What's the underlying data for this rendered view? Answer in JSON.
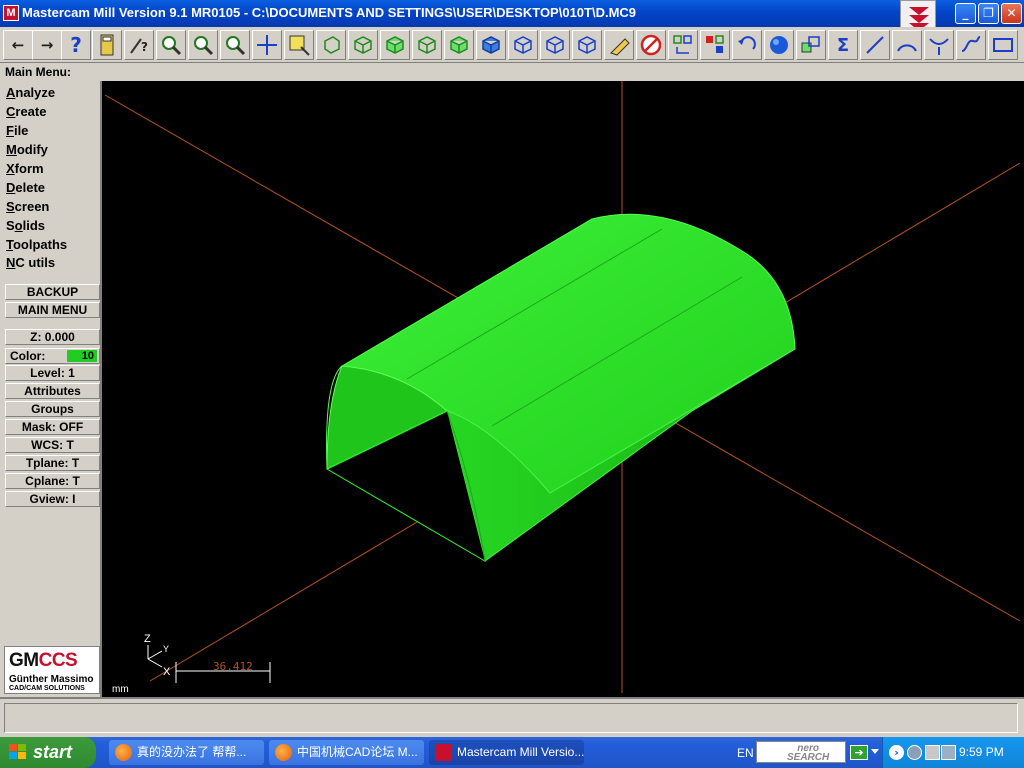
{
  "window": {
    "title": "Mastercam Mill Version 9.1 MR0105 - C:\\DOCUMENTS AND SETTINGS\\USER\\DESKTOP\\010T\\D.MC9",
    "app_icon": "M"
  },
  "menu": {
    "header": "Main Menu:",
    "items": [
      {
        "u": "A",
        "rest": "nalyze"
      },
      {
        "u": "C",
        "rest": "reate"
      },
      {
        "u": "F",
        "rest": "ile"
      },
      {
        "u": "M",
        "rest": "odify"
      },
      {
        "u": "X",
        "rest": "form"
      },
      {
        "u": "D",
        "rest": "elete"
      },
      {
        "u": "S",
        "rest": "creen"
      },
      {
        "pre": "S",
        "u": "o",
        "rest": "lids"
      },
      {
        "u": "T",
        "rest": "oolpaths"
      },
      {
        "u": "N",
        "rest": "C utils"
      }
    ],
    "backup": "BACKUP",
    "main_menu": "MAIN MENU"
  },
  "status": {
    "z": "Z:  0.000",
    "color_label": "Color:",
    "color_value": "10",
    "level": "Level:  1",
    "attributes": "Attributes",
    "groups": "Groups",
    "mask": "Mask:  OFF",
    "wcs": "WCS:   T",
    "tplane": "Tplane:  T",
    "cplane": "Cplane:  T",
    "gview": "Gview:   I"
  },
  "logo": {
    "big_a": "GM",
    "big_b": "CCS",
    "line1": "Günther Massimo",
    "line2": "CAD/CAM SOLUTIONS"
  },
  "viewport": {
    "axis_z": "Z",
    "axis_y": "Y",
    "axis_x": "X",
    "scale_value": "36.412",
    "units": "mm"
  },
  "taskbar": {
    "start": "start",
    "tasks": [
      {
        "label": "真的没办法了 帮帮...",
        "icon": "firefox-icon"
      },
      {
        "label": "中国机械CAD论坛 M...",
        "icon": "firefox-icon"
      },
      {
        "label": "Mastercam Mill Versio...",
        "icon": "mastercam-icon"
      }
    ],
    "language": "EN",
    "nero_search_line1": "nero",
    "nero_search_line2": "SEARCH",
    "clock": "9:59 PM"
  },
  "colors": {
    "solid": "#22e01e",
    "axis": "#b4541e",
    "title_bar": "#0445c8",
    "panel": "#d4d0c8"
  }
}
